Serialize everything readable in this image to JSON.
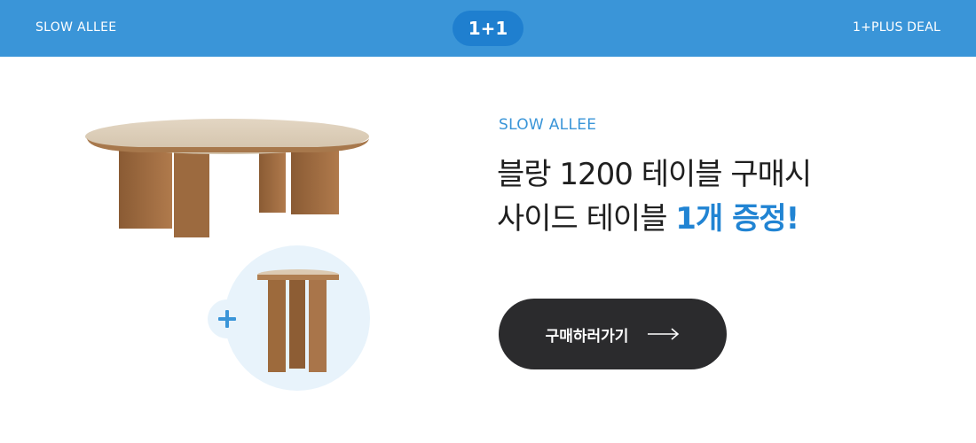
{
  "header": {
    "brand": "SLOW ALLEE",
    "badge": "1+1",
    "deal": "1+PLUS DEAL",
    "colors": {
      "bar": "#3a95d8",
      "badge": "#1f7fcf"
    }
  },
  "product": {
    "main_image_icon": "oval-dining-table-icon",
    "gift_image_icon": "side-table-icon",
    "plus_icon": "plus-icon"
  },
  "promo": {
    "eyebrow": "SLOW ALLEE",
    "headline_line1": "블랑 1200 테이블 구매시",
    "headline_line2_prefix": "사이드 테이블 ",
    "headline_line2_accent": "1개 증정!",
    "accent_color": "#2184d3"
  },
  "cta": {
    "label": "구매하러가기",
    "icon": "arrow-right-icon",
    "color": "#2b2b2d"
  }
}
